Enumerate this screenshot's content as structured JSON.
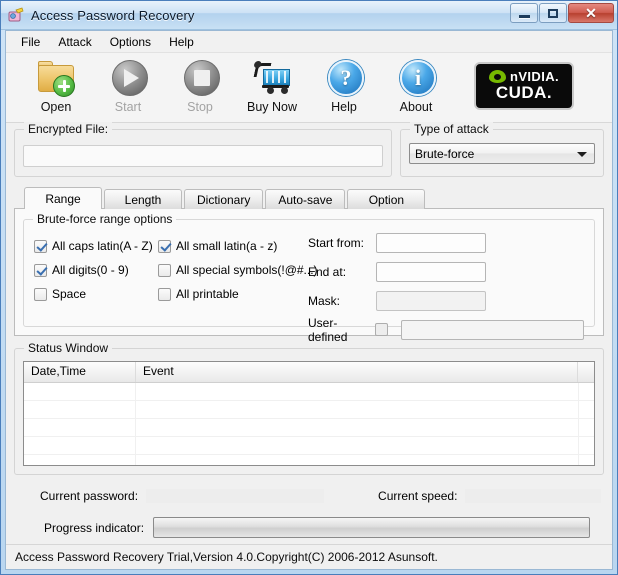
{
  "window": {
    "title": "Access Password Recovery",
    "icon": "app-key-icon",
    "controls": {
      "minimize": "minimize-icon",
      "maximize": "maximize-icon",
      "close": "✕"
    }
  },
  "menu": {
    "items": [
      {
        "label": "File"
      },
      {
        "label": "Attack"
      },
      {
        "label": "Options"
      },
      {
        "label": "Help"
      }
    ]
  },
  "toolbar": {
    "buttons": [
      {
        "label": "Open",
        "icon": "open-folder-icon",
        "enabled": true
      },
      {
        "label": "Start",
        "icon": "play-circle-icon",
        "enabled": false
      },
      {
        "label": "Stop",
        "icon": "stop-circle-icon",
        "enabled": false
      },
      {
        "label": "Buy Now",
        "icon": "shopping-cart-icon",
        "enabled": true
      },
      {
        "label": "Help",
        "icon": "question-orb-icon",
        "enabled": true
      },
      {
        "label": "About",
        "icon": "info-orb-icon",
        "enabled": true
      }
    ],
    "badge": {
      "brand": "nVIDIA.",
      "platform": "CUDA.",
      "accent_color": "#76b900"
    }
  },
  "encrypted_file": {
    "group_title": "Encrypted File:",
    "value": "",
    "placeholder": ""
  },
  "attack": {
    "group_title": "Type of attack",
    "selected": "Brute-force",
    "options": [
      "Brute-force"
    ]
  },
  "tabs": {
    "items": [
      {
        "label": "Range",
        "active": true
      },
      {
        "label": "Length",
        "active": false
      },
      {
        "label": "Dictionary",
        "active": false
      },
      {
        "label": "Auto-save",
        "active": false
      },
      {
        "label": "Option",
        "active": false
      }
    ]
  },
  "range_panel": {
    "group_title": "Brute-force range options",
    "checkboxes": [
      {
        "label": "All caps latin(A - Z)",
        "checked": true
      },
      {
        "label": "All small latin(a - z)",
        "checked": true
      },
      {
        "label": "All digits(0 - 9)",
        "checked": true
      },
      {
        "label": "All special symbols(!@#...)",
        "checked": false
      },
      {
        "label": "Space",
        "checked": false
      },
      {
        "label": "All printable",
        "checked": false
      }
    ],
    "fields": [
      {
        "label": "Start from:",
        "value": "",
        "disabled": false
      },
      {
        "label": "End at:",
        "value": "",
        "disabled": false
      },
      {
        "label": "Mask:",
        "value": "",
        "disabled": true
      }
    ],
    "user_defined": {
      "label": "User-defined",
      "checked": false,
      "value": ""
    }
  },
  "status_window": {
    "group_title": "Status Window",
    "columns": [
      "Date,Time",
      "Event",
      ""
    ],
    "rows": []
  },
  "bottom": {
    "current_password_label": "Current password:",
    "current_password_value": "",
    "current_speed_label": "Current speed:",
    "current_speed_value": "",
    "progress_label": "Progress indicator:",
    "progress_percent": 0
  },
  "statusbar": {
    "text": "Access Password Recovery Trial,Version 4.0.Copyright(C) 2006-2012 Asunsoft."
  }
}
